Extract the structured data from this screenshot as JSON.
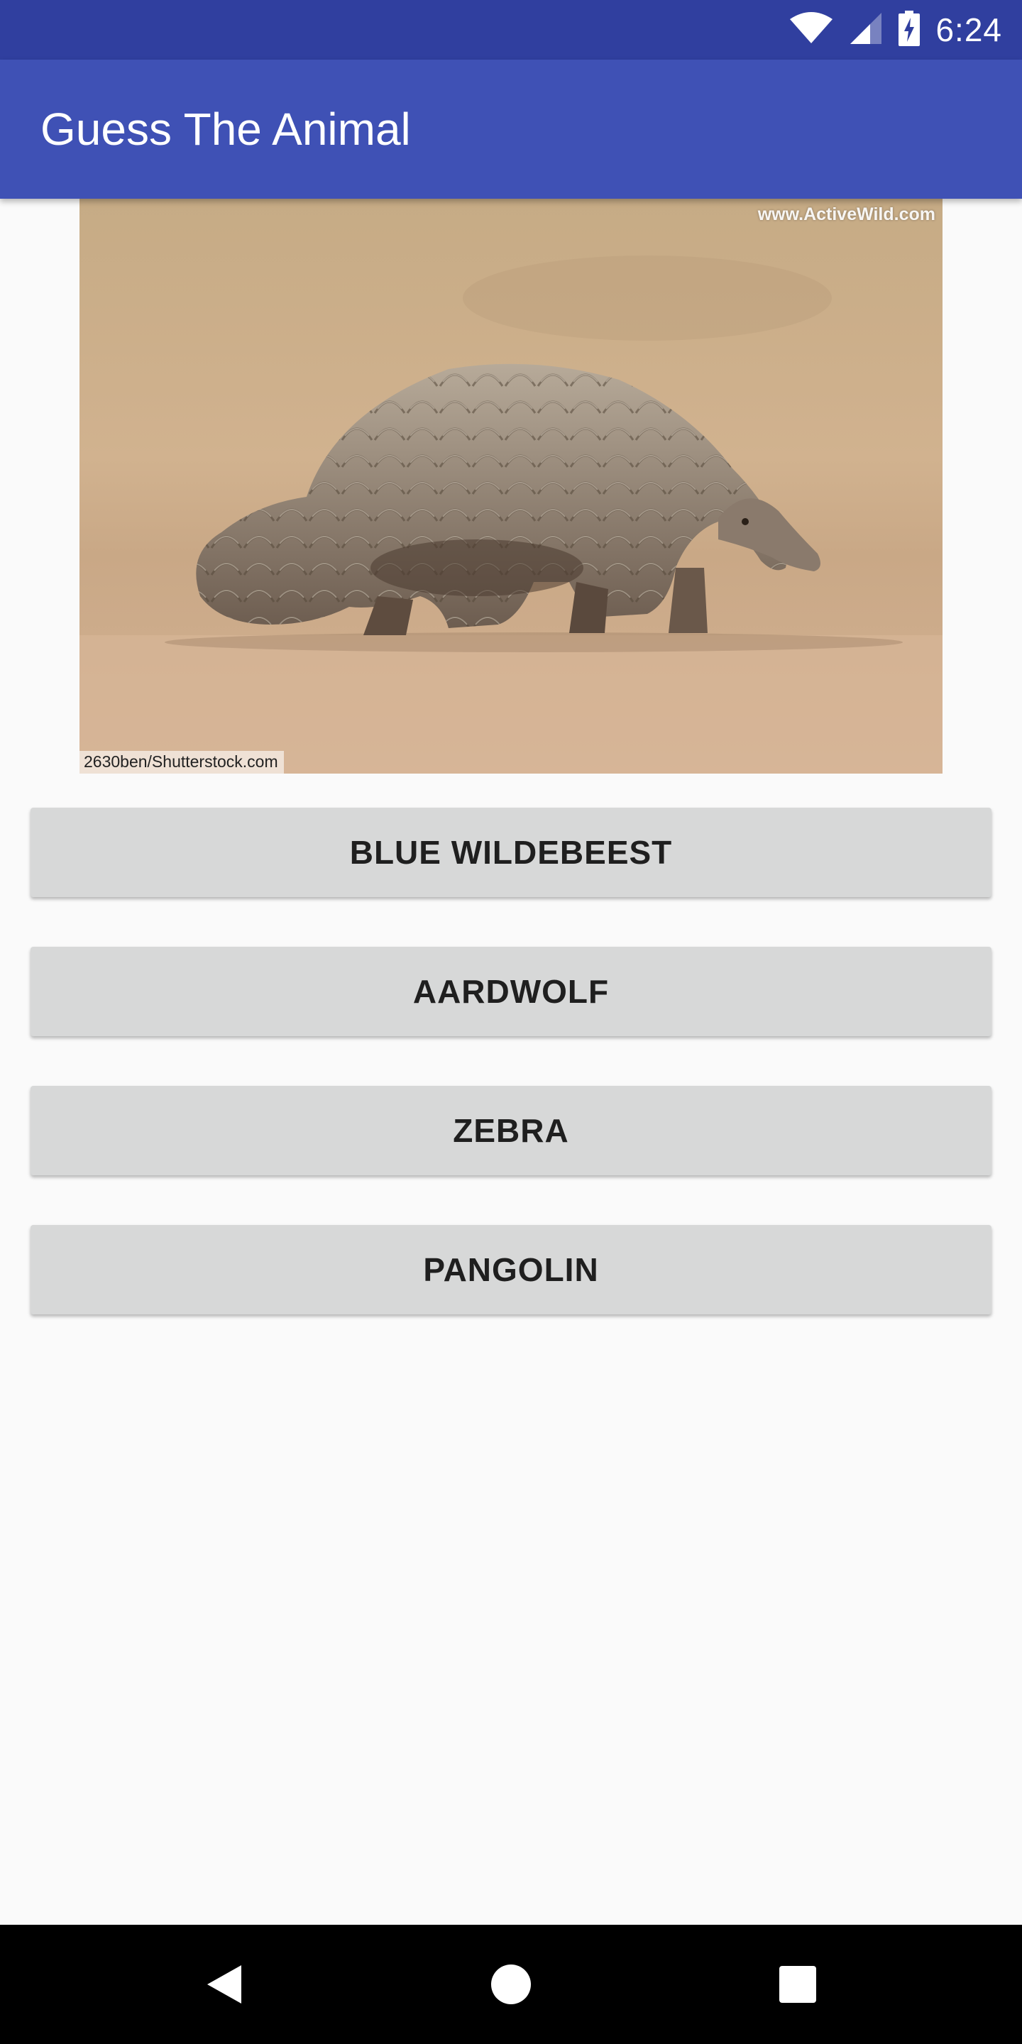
{
  "status_bar": {
    "time": "6:24",
    "icons": [
      "wifi-icon",
      "cell-signal-icon",
      "battery-charging-icon"
    ]
  },
  "app_bar": {
    "title": "Guess The Animal"
  },
  "photo": {
    "subject": "pangolin",
    "watermark_top": "www.ActiveWild.com",
    "watermark_bottom": "2630ben/Shutterstock.com"
  },
  "answers": [
    {
      "label": "BLUE WILDEBEEST"
    },
    {
      "label": "AARDWOLF"
    },
    {
      "label": "ZEBRA"
    },
    {
      "label": "PANGOLIN"
    }
  ],
  "nav_bar": {
    "icons": [
      "back-icon",
      "home-icon",
      "recents-icon"
    ]
  },
  "colors": {
    "status_bar": "#303f9f",
    "app_bar": "#3f51b5",
    "button": "#d7d8d8",
    "background": "#fafafa"
  }
}
